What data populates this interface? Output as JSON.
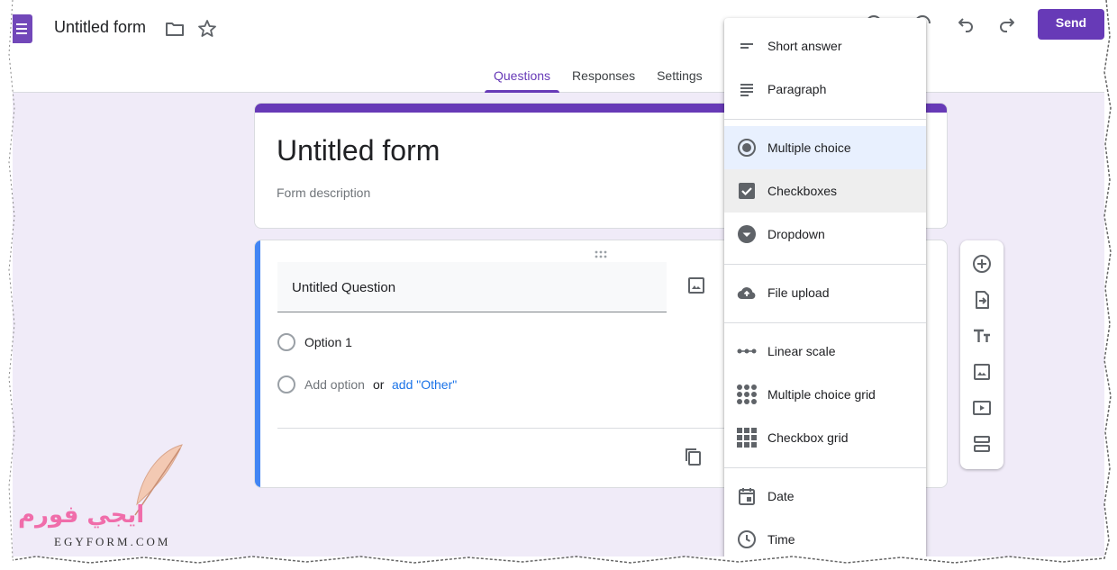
{
  "header": {
    "doc_title": "Untitled form",
    "send_label": "Send",
    "tabs": [
      {
        "label": "Questions",
        "active": true
      },
      {
        "label": "Responses",
        "active": false
      },
      {
        "label": "Settings",
        "active": false
      }
    ]
  },
  "form": {
    "title": "Untitled form",
    "description_placeholder": "Form description"
  },
  "question": {
    "title": "Untitled Question",
    "option1": "Option 1",
    "add_option": "Add option",
    "or": "or",
    "add_other": "add \"Other\""
  },
  "menu": {
    "items": [
      {
        "label": "Short answer",
        "icon": "short-answer-icon"
      },
      {
        "label": "Paragraph",
        "icon": "paragraph-icon"
      },
      {
        "label": "Multiple choice",
        "icon": "radio-button-icon",
        "selected": true
      },
      {
        "label": "Checkboxes",
        "icon": "checkbox-icon",
        "hover": true
      },
      {
        "label": "Dropdown",
        "icon": "dropdown-circle-icon"
      },
      {
        "label": "File upload",
        "icon": "cloud-upload-icon"
      },
      {
        "label": "Linear scale",
        "icon": "linear-scale-icon"
      },
      {
        "label": "Multiple choice grid",
        "icon": "dots-grid-icon"
      },
      {
        "label": "Checkbox grid",
        "icon": "squares-grid-icon"
      },
      {
        "label": "Date",
        "icon": "calendar-icon"
      },
      {
        "label": "Time",
        "icon": "clock-icon"
      }
    ]
  },
  "toolbar": {
    "icons": [
      "add-question-icon",
      "import-questions-icon",
      "add-title-icon",
      "add-image-icon",
      "add-video-icon",
      "add-section-icon"
    ]
  },
  "watermark": {
    "arabic": "ايجي فورم",
    "latin": "EGYFORM.COM"
  },
  "colors": {
    "accent": "#673ab7",
    "page_bg": "#f0ebf8",
    "link": "#1a73e8",
    "question_bar": "#4285f4"
  }
}
